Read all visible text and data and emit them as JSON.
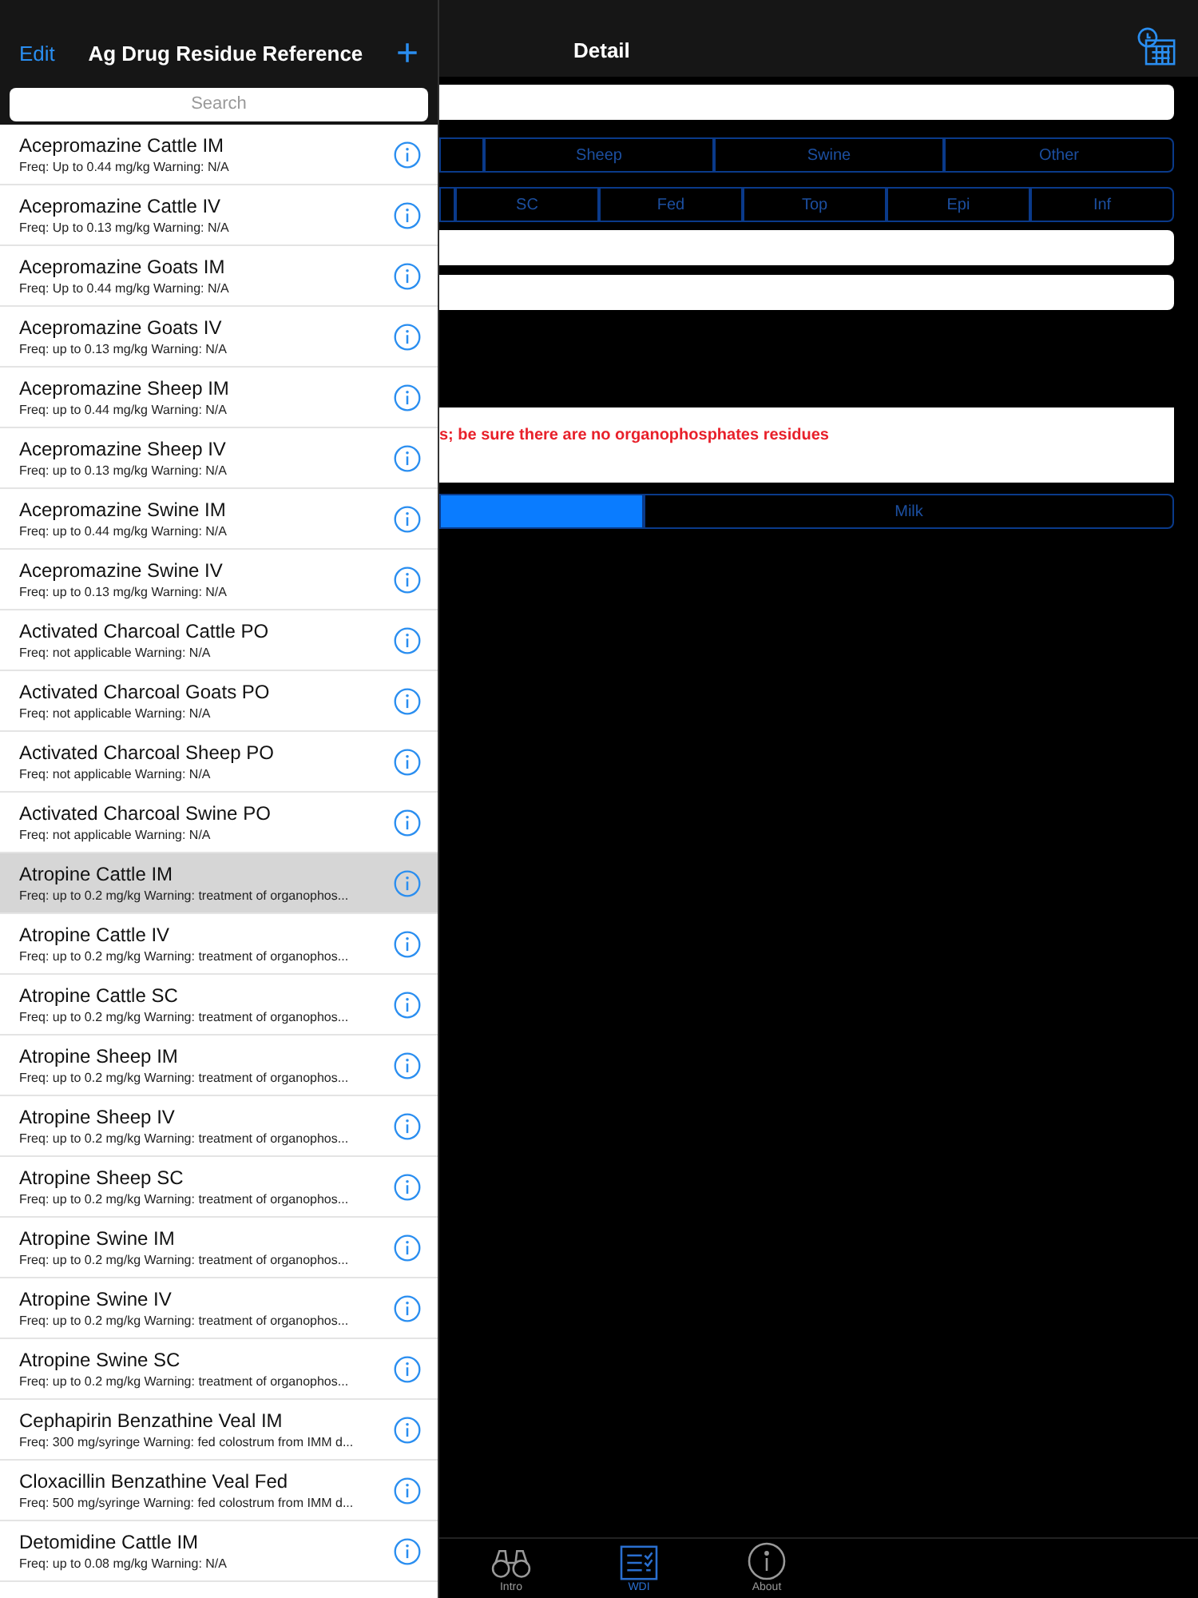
{
  "master": {
    "edit": "Edit",
    "title": "Ag Drug Residue Reference",
    "add": "+",
    "search": {
      "placeholder": "Search"
    },
    "rows": [
      {
        "title": "Acepromazine Cattle IM",
        "subtitle": "Freq: Up to 0.44 mg/kg Warning: N/A",
        "selected": false
      },
      {
        "title": "Acepromazine Cattle IV",
        "subtitle": "Freq: Up to 0.13 mg/kg Warning: N/A",
        "selected": false
      },
      {
        "title": "Acepromazine Goats IM",
        "subtitle": "Freq: Up to 0.44 mg/kg Warning: N/A",
        "selected": false
      },
      {
        "title": "Acepromazine Goats IV",
        "subtitle": "Freq: up to 0.13 mg/kg Warning: N/A",
        "selected": false
      },
      {
        "title": "Acepromazine Sheep IM",
        "subtitle": "Freq: up to 0.44 mg/kg Warning: N/A",
        "selected": false
      },
      {
        "title": "Acepromazine Sheep IV",
        "subtitle": "Freq: up to 0.13 mg/kg Warning: N/A",
        "selected": false
      },
      {
        "title": "Acepromazine Swine IM",
        "subtitle": "Freq: up to 0.44 mg/kg Warning: N/A",
        "selected": false
      },
      {
        "title": "Acepromazine Swine IV",
        "subtitle": "Freq: up to 0.13 mg/kg Warning: N/A",
        "selected": false
      },
      {
        "title": "Activated Charcoal Cattle PO",
        "subtitle": "Freq: not applicable Warning: N/A",
        "selected": false
      },
      {
        "title": "Activated Charcoal Goats PO",
        "subtitle": "Freq: not applicable Warning: N/A",
        "selected": false
      },
      {
        "title": "Activated Charcoal Sheep PO",
        "subtitle": "Freq: not applicable Warning: N/A",
        "selected": false
      },
      {
        "title": "Activated Charcoal Swine PO",
        "subtitle": "Freq: not applicable Warning: N/A",
        "selected": false
      },
      {
        "title": "Atropine Cattle IM",
        "subtitle": "Freq: up to 0.2 mg/kg Warning:  treatment of organophos...",
        "selected": true
      },
      {
        "title": "Atropine Cattle IV",
        "subtitle": "Freq: up to 0.2 mg/kg Warning:  treatment of organophos...",
        "selected": false
      },
      {
        "title": "Atropine Cattle SC",
        "subtitle": "Freq: up to 0.2 mg/kg Warning:  treatment of organophos...",
        "selected": false
      },
      {
        "title": "Atropine Sheep IM",
        "subtitle": "Freq: up to 0.2 mg/kg Warning:  treatment of organophos...",
        "selected": false
      },
      {
        "title": "Atropine Sheep IV",
        "subtitle": "Freq: up to 0.2 mg/kg Warning:  treatment of organophos...",
        "selected": false
      },
      {
        "title": "Atropine Sheep SC",
        "subtitle": "Freq: up to 0.2 mg/kg Warning:  treatment of organophos...",
        "selected": false
      },
      {
        "title": "Atropine Swine IM",
        "subtitle": "Freq: up to 0.2 mg/kg Warning:  treatment of organophos...",
        "selected": false
      },
      {
        "title": "Atropine Swine IV",
        "subtitle": "Freq: up to 0.2 mg/kg Warning:  treatment of organophos...",
        "selected": false
      },
      {
        "title": "Atropine Swine SC",
        "subtitle": "Freq: up to 0.2 mg/kg Warning:  treatment of organophos...",
        "selected": false
      },
      {
        "title": "Cephapirin Benzathine Veal IM",
        "subtitle": "Freq: 300 mg/syringe Warning: fed colostrum from IMM d...",
        "selected": false
      },
      {
        "title": "Cloxacillin Benzathine Veal Fed",
        "subtitle": "Freq: 500 mg/syringe Warning: fed colostrum from IMM d...",
        "selected": false
      },
      {
        "title": "Detomidine Cattle IM",
        "subtitle": "Freq: up to 0.08 mg/kg Warning: N/A",
        "selected": false
      }
    ]
  },
  "detail": {
    "title": "Detail",
    "species_segments": [
      {
        "selected": false
      },
      {
        "label": "Sheep",
        "selected": false
      },
      {
        "label": "Swine",
        "selected": false
      },
      {
        "label": "Other",
        "selected": false
      }
    ],
    "route_segments": [
      {
        "selected": false
      },
      {
        "label": "SC",
        "selected": false
      },
      {
        "label": "Fed",
        "selected": false
      },
      {
        "label": "Top",
        "selected": false
      },
      {
        "label": "Epi",
        "selected": false
      },
      {
        "label": "Inf",
        "selected": false
      }
    ],
    "warning": "s; be sure there are no organophosphates residues",
    "product_segments": [
      {
        "selected": true
      },
      {
        "label": "Milk",
        "selected": false
      }
    ]
  },
  "tab_bar": [
    {
      "kind": "binoculars",
      "label": "Intro",
      "selected": false
    },
    {
      "kind": "list",
      "label": "WDI",
      "selected": true
    },
    {
      "kind": "info",
      "label": "About",
      "selected": false
    }
  ]
}
